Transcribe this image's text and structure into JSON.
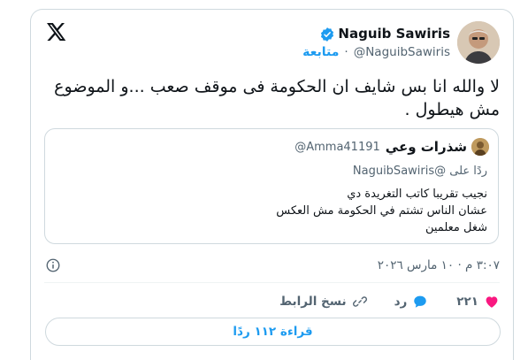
{
  "author": {
    "display_name": "Naguib Sawiris",
    "handle": "@NaguibSawiris",
    "follow_label": "متابعة",
    "dot": "·"
  },
  "tweet": {
    "text": "لا والله انا بس شايف ان الحكومة فى موقف صعب ...و الموضوع مش هيطول ."
  },
  "quote": {
    "display_name": "شذرات وعي",
    "handle": "@Amma41191",
    "reply_prefix": "ردًا على",
    "reply_to": "@NaguibSawiris",
    "text": "نجيب تقريبا كاتب التغريدة دي\nعشان الناس تشتم في الحكومة مش العكس\nشغل معلمين"
  },
  "meta": {
    "timestamp": "٣:٠٧ م · ١٠ مارس ٢٠٢٦"
  },
  "actions": {
    "like_count": "٢٢١",
    "reply_label": "رد",
    "copy_link_label": "نسخ الرابط"
  },
  "read_replies_label": "قراءة ١١٢ ردًا",
  "colors": {
    "accent": "#1d9bf0",
    "like": "#f91880",
    "text_secondary": "#536471",
    "border": "#cfd9de"
  },
  "icons": [
    "x-logo-icon",
    "verified-badge-icon",
    "info-icon",
    "heart-icon",
    "reply-bubble-icon",
    "link-icon"
  ]
}
